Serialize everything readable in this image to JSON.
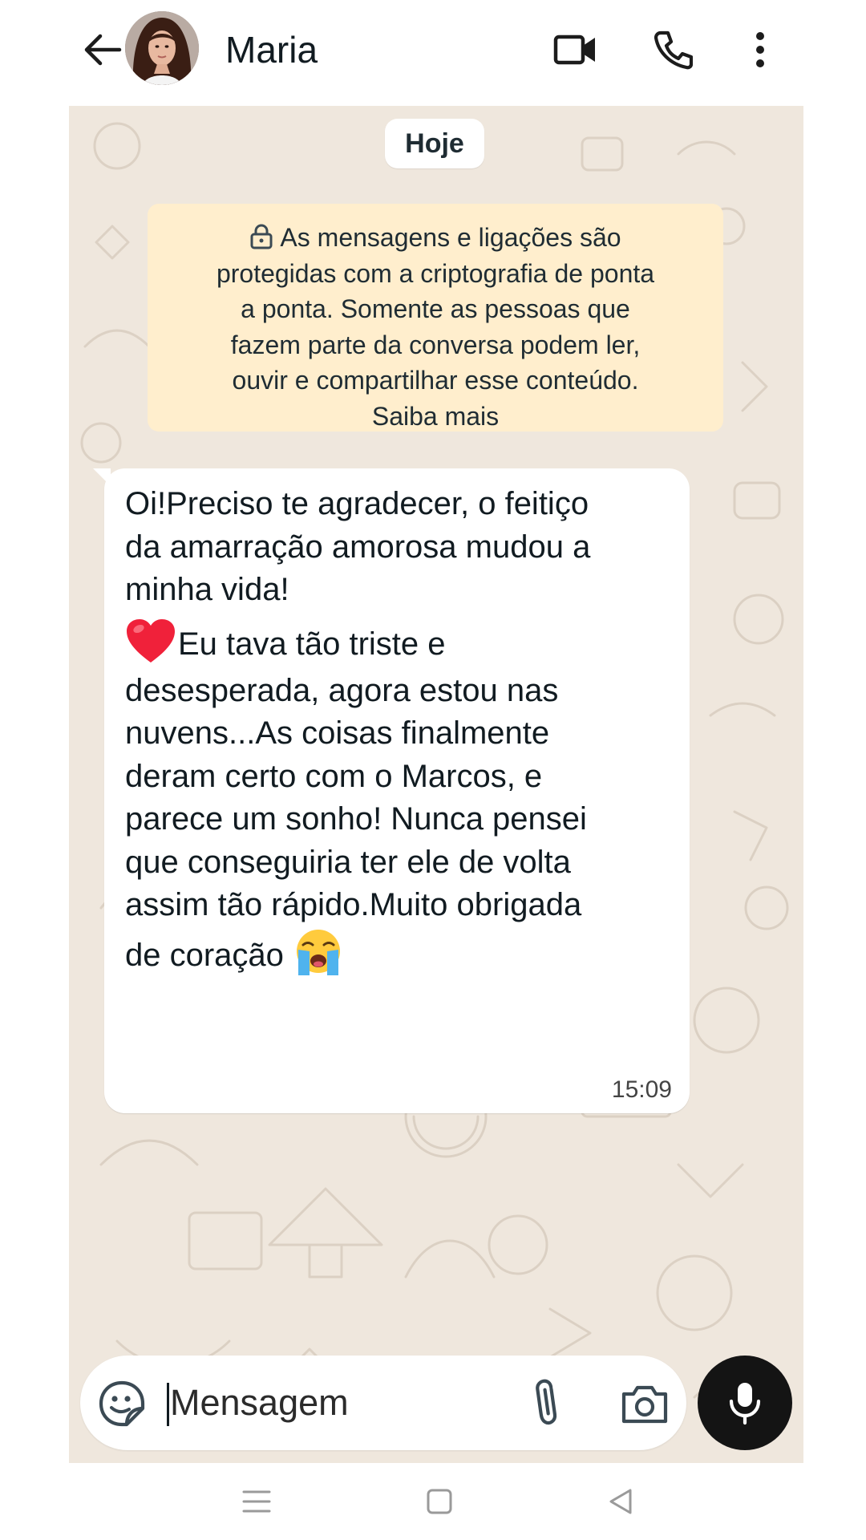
{
  "header": {
    "contact_name": "Maria",
    "back_icon": "arrow-left-icon",
    "video_icon": "video-camera-icon",
    "call_icon": "phone-icon",
    "menu_icon": "more-vertical-icon"
  },
  "chat": {
    "date_label": "Hoje",
    "encryption_notice": {
      "icon": "lock-icon",
      "lines": [
        "As mensagens e ligações são",
        "protegidas com a criptografia de ponta",
        "a ponta. Somente as pessoas que",
        "fazem parte da conversa podem ler,",
        "ouvir e compartilhar esse conteúdo."
      ],
      "learn_more": "Saiba mais"
    },
    "message": {
      "p1_lines": [
        "Oi!Preciso te agradecer, o feitiço",
        "da amarração amorosa mudou a",
        "minha vida!"
      ],
      "p2_first_line": "Eu tava tão triste e",
      "p2_lines": [
        "desesperada, agora estou nas",
        "nuvens...As coisas finalmente",
        "deram certo com o Marcos, e",
        "parece um sonho! Nunca pensei",
        "que conseguiria ter ele de volta",
        "assim tão rápido.Muito obrigada"
      ],
      "p2_last_line": "de coração",
      "time": "15:09",
      "emojis": [
        "red-heart-emoji",
        "loudly-crying-face-emoji"
      ]
    }
  },
  "composer": {
    "placeholder": "Mensagem",
    "emoji_icon": "sticker-smiley-icon",
    "attach_icon": "paperclip-icon",
    "camera_icon": "camera-icon",
    "mic_icon": "microphone-icon"
  },
  "navbar": {
    "icons": [
      "menu-icon",
      "home-icon",
      "back-triangle-icon"
    ]
  },
  "colors": {
    "chat_background": "#efe7dd",
    "notice_background": "#ffeecd",
    "bubble_background": "#ffffff",
    "mic_button": "#141414"
  }
}
